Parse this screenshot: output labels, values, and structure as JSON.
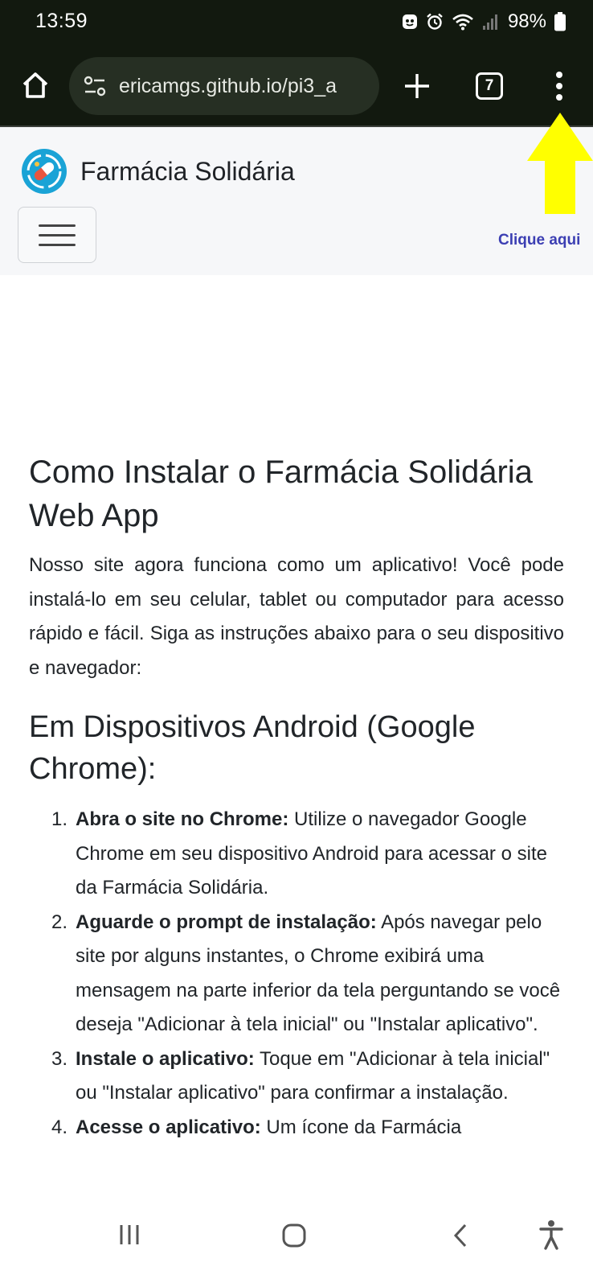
{
  "status_bar": {
    "time": "13:59",
    "battery": "98%",
    "icons": [
      "app-notification-icon",
      "alarm-icon",
      "wifi-icon",
      "signal-icon",
      "battery-icon"
    ]
  },
  "browser": {
    "url": "ericamgs.github.io/pi3_a",
    "tab_count": "7",
    "icons": [
      "home-icon",
      "tune-icon",
      "plus-icon",
      "tabs-icon",
      "more-vert-icon"
    ]
  },
  "navbar": {
    "brand_name": "Farmácia Solidária",
    "hint_label": "Clique aqui",
    "arrow_color": "#ffff00"
  },
  "main": {
    "heading": "Como Instalar o Farmácia Solidária Web App",
    "intro": "Nosso site agora funciona como um aplicativo! Você pode instalá-lo em seu celular, tablet ou computador para acesso rápido e fácil. Siga as instruções abaixo para o seu dispositivo e navegador:",
    "android_heading": "Em Dispositivos Android (Google Chrome):",
    "steps": [
      {
        "num": "1.",
        "title": "Abra o site no Chrome:",
        "text": " Utilize o navegador Google Chrome em seu dispositivo Android para acessar o site da Farmácia Solidária."
      },
      {
        "num": "2.",
        "title": "Aguarde o prompt de instalação:",
        "text": " Após navegar pelo site por alguns instantes, o Chrome exibirá uma mensagem na parte inferior da tela perguntando se você deseja \"Adicionar à tela inicial\" ou \"Instalar aplicativo\"."
      },
      {
        "num": "3.",
        "title": "Instale o aplicativo:",
        "text": " Toque em \"Adicionar à tela inicial\" ou \"Instalar aplicativo\" para confirmar a instalação."
      },
      {
        "num": "4.",
        "title": "Acesse o aplicativo:",
        "text": " Um ícone da Farmácia"
      }
    ]
  },
  "system_nav": {
    "icons": [
      "recent-apps-icon",
      "home-circle-icon",
      "back-icon",
      "accessibility-icon"
    ]
  }
}
